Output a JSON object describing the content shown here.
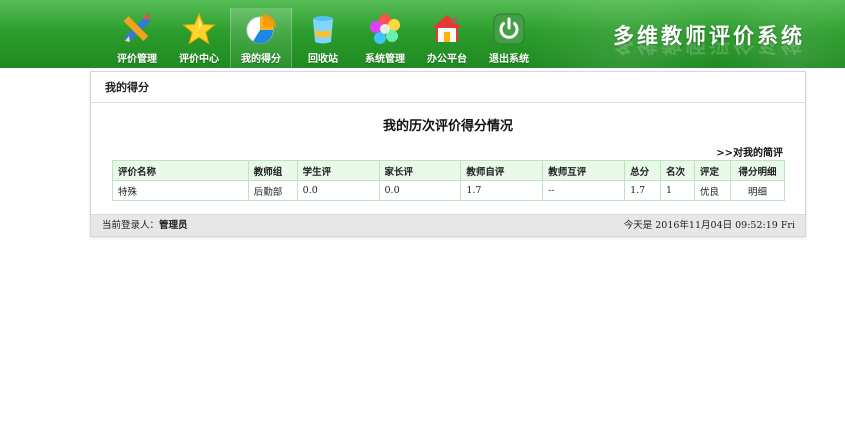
{
  "header": {
    "system_title": "多维教师评价系统",
    "nav": [
      {
        "label": "评价管理",
        "icon": "pencil-ruler-icon"
      },
      {
        "label": "评价中心",
        "icon": "star-icon"
      },
      {
        "label": "我的得分",
        "icon": "pie-chart-icon",
        "active": true
      },
      {
        "label": "回收站",
        "icon": "trash-bin-icon"
      },
      {
        "label": "系统管理",
        "icon": "flower-icon"
      },
      {
        "label": "办公平台",
        "icon": "house-icon"
      },
      {
        "label": "退出系统",
        "icon": "power-icon"
      }
    ],
    "colors": {
      "header_green": "#2a9a2a",
      "table_border": "#bfe3bf",
      "table_header_bg": "#e9f9e9"
    }
  },
  "panel": {
    "heading": "我的得分",
    "title": "我的历次评价得分情况",
    "mine_link": ">>对我的简评",
    "table": {
      "headers": [
        "评价名称",
        "教师组",
        "学生评",
        "家长评",
        "教师自评",
        "教师互评",
        "总分",
        "名次",
        "评定",
        "得分明细"
      ],
      "rows": [
        [
          "特殊",
          "后勤部",
          "0.0",
          "0.0",
          "1.7",
          "--",
          "1.7",
          "1",
          "优良",
          "明细"
        ]
      ]
    }
  },
  "footer": {
    "login_prefix": "当前登录人：",
    "login_user": "管理员",
    "datetime": "今天是 2016年11月04日  09:52:19 Fri"
  }
}
